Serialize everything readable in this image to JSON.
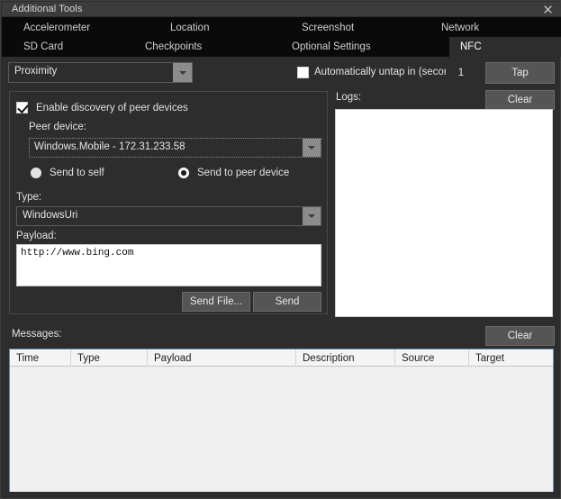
{
  "window": {
    "title": "Additional Tools",
    "close_icon": "close-icon"
  },
  "tabs": {
    "row1": [
      {
        "label": "Accelerometer",
        "selected": false
      },
      {
        "label": "Location",
        "selected": false
      },
      {
        "label": "Screenshot",
        "selected": false
      },
      {
        "label": "Network",
        "selected": false
      }
    ],
    "row2": [
      {
        "label": "SD Card",
        "selected": false
      },
      {
        "label": "Checkpoints",
        "selected": false
      },
      {
        "label": "Optional Settings",
        "selected": false
      },
      {
        "label": "NFC",
        "selected": true
      }
    ]
  },
  "toolbar": {
    "mode_combo_value": "Proximity",
    "auto_untap_label": "Automatically untap in (seconds):",
    "auto_untap_checked": false,
    "auto_untap_seconds": "1",
    "tap_button": "Tap"
  },
  "discovery": {
    "enable_label": "Enable discovery of peer devices",
    "enable_checked": true,
    "peer_device_label": "Peer device:",
    "peer_device_value": "Windows.Mobile - 172.31.233.58",
    "radio_self_label": "Send to self",
    "radio_peer_label": "Send to peer device",
    "selected_target": "peer",
    "type_label": "Type:",
    "type_value": "WindowsUri",
    "payload_label": "Payload:",
    "payload_value": "http://www.bing.com",
    "send_file_button": "Send File...",
    "send_button": "Send"
  },
  "logs": {
    "label": "Logs:",
    "clear_button": "Clear",
    "content": ""
  },
  "messages": {
    "label": "Messages:",
    "clear_button": "Clear",
    "columns": [
      "Time",
      "Type",
      "Payload",
      "Description",
      "Source",
      "Target"
    ],
    "rows": []
  },
  "colors": {
    "window_bg": "#2d2d2d",
    "titlebar_bg": "#3c3c3c",
    "tabstrip_bg": "#0a0a0a",
    "selected_tab_bg": "#2d2d2d",
    "button_bg": "#555555",
    "text": "#e2e2e2",
    "field_bg": "#ffffff",
    "table_border": "#6f89a8"
  }
}
